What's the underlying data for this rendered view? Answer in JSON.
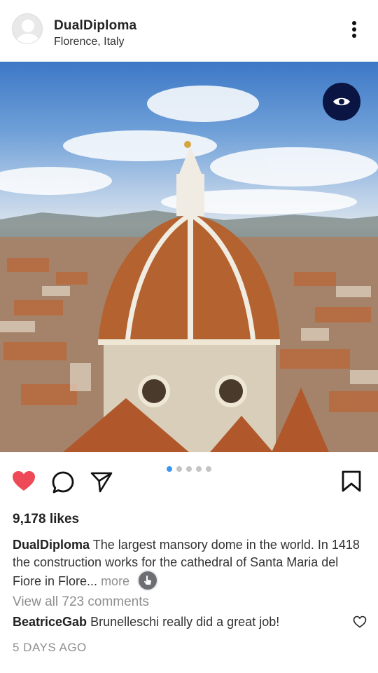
{
  "post": {
    "username": "DualDiploma",
    "location": "Florence, Italy",
    "image_alt": "Aerial view of Brunelleschi's dome, Florence cathedral",
    "carousel": {
      "count": 5,
      "active_index": 0
    },
    "likes_text": "9,178 likes",
    "caption": {
      "username": "DualDiploma",
      "text": "The largest mansory dome in the world. In 1418 the construction works for the cathedral of Santa Maria del Fiore in Flore...",
      "more_label": "more"
    },
    "view_all_comments": "View all 723 comments",
    "top_comment": {
      "username": "BeatriceGab",
      "text": "Brunelleschi really did a great job!"
    },
    "timestamp": "5 DAYS AGO"
  },
  "icons": {
    "options": "more-vertical-icon",
    "overlay": "eye-icon",
    "like": "heart-icon",
    "comment": "comment-icon",
    "share": "send-icon",
    "save": "bookmark-icon",
    "comment_like": "heart-outline-icon"
  },
  "colors": {
    "like_red": "#ed4956",
    "dot_active": "#3897f0",
    "eye_badge": "#0a1543"
  }
}
